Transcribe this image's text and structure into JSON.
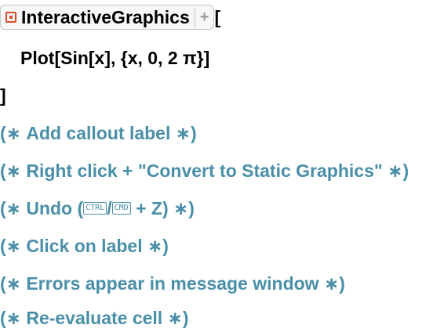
{
  "input": {
    "function_name": "InteractiveGraphics",
    "chip_icon": "resource-function-icon",
    "chip_expand": "+",
    "open_bracket": "[",
    "body": "Plot[Sin[x], {x, 0, 2 π}]",
    "close_bracket": "]"
  },
  "comments": [
    {
      "open": "(∗",
      "text": "Add callout label",
      "close": "∗)"
    },
    {
      "open": "(∗",
      "text": "Right click + \"Convert to Static Graphics\"",
      "close": "∗)"
    },
    {
      "open": "(∗",
      "prefix": "Undo (",
      "key1": "CTRL",
      "slash": "/",
      "key2": "CMD",
      "suffix": " + Z)",
      "close": "∗)"
    },
    {
      "open": "(∗",
      "text": "Click on label",
      "close": "∗)"
    },
    {
      "open": "(∗",
      "text": "Errors appear in message window",
      "close": "∗)"
    },
    {
      "open": "(∗",
      "text": "Re-evaluate cell",
      "close": "∗)"
    }
  ],
  "colors": {
    "code": "#000000",
    "comment": "#4a8fa8",
    "chip_icon": "#d94a2b"
  }
}
